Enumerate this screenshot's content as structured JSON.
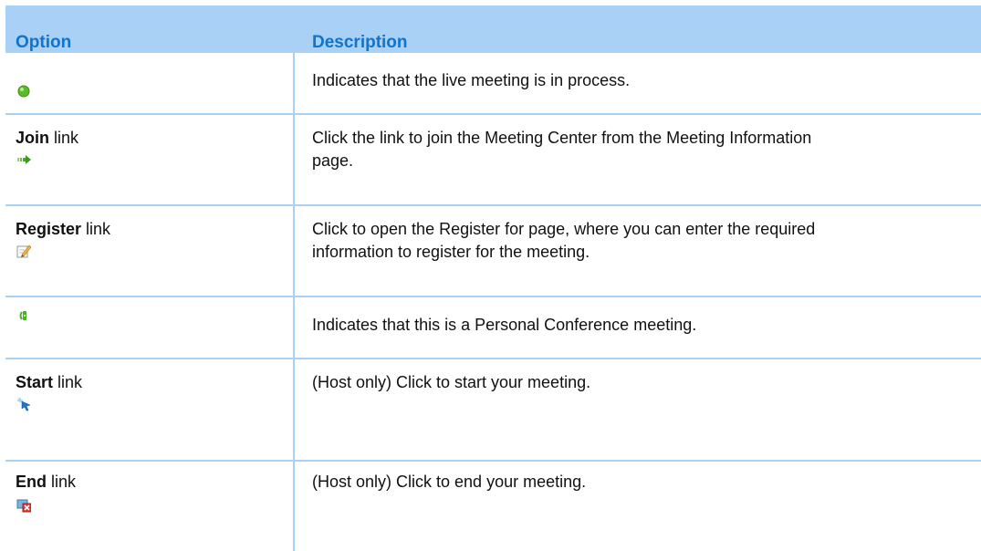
{
  "headers": {
    "option": "Option",
    "description": "Description"
  },
  "rows": [
    {
      "option_bold": "",
      "option_rest": "",
      "icon": "green-circle-icon",
      "description": "Indicates that the live meeting is in process."
    },
    {
      "option_bold": "Join",
      "option_rest": " link",
      "icon": "join-arrow-icon",
      "description": "Click the link to join the Meeting Center from the Meeting Information page."
    },
    {
      "option_bold": "Register",
      "option_rest": " link",
      "icon": "register-pencil-icon",
      "description": "Click to open the Register for page, where you can enter the required information to register for the meeting."
    },
    {
      "option_bold": "",
      "option_rest": "",
      "icon": "personal-conference-phone-icon",
      "description": "Indicates that this is a Personal Conference meeting."
    },
    {
      "option_bold": "Start",
      "option_rest": " link",
      "icon": "start-sparkle-icon",
      "description": "(Host only) Click to start your meeting."
    },
    {
      "option_bold": "End",
      "option_rest": " link",
      "icon": "end-close-icon",
      "description": "(Host only) Click to end your meeting."
    }
  ]
}
